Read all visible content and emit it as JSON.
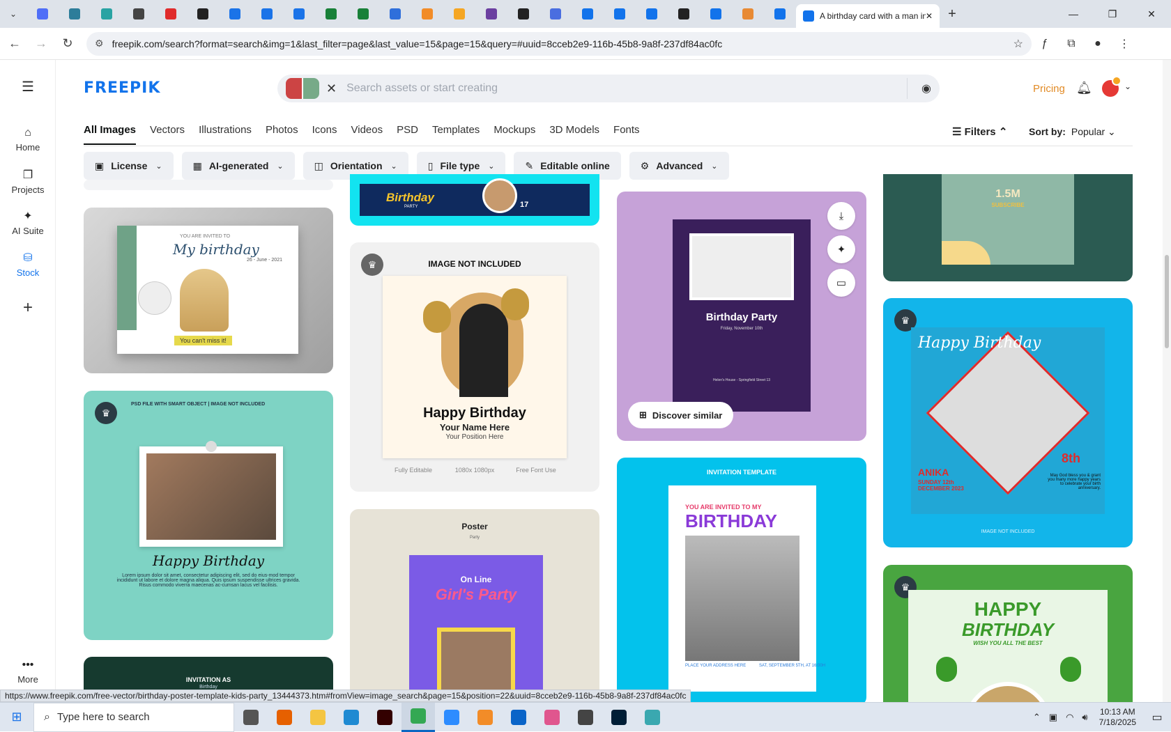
{
  "browser": {
    "active_tab_title": "A birthday card with a man in a",
    "url": "freepik.com/search?format=search&img=1&last_filter=page&last_value=15&page=15&query=#uuid=8cceb2e9-116b-45b8-9a8f-237df84ac0fc",
    "tab_favicon_colors": [
      "#4f6ef7",
      "#2d7d9a",
      "#29a3a3",
      "#444444",
      "#e02b2b",
      "#222222",
      "#1a73e8",
      "#1a73e8",
      "#1a73e8",
      "#188038",
      "#188038",
      "#2f6fdb",
      "#f28c28",
      "#f5a623",
      "#6b3fa0",
      "#222222",
      "#4a6ee0",
      "#1273eb",
      "#1273eb",
      "#1273eb",
      "#222222",
      "#1273eb",
      "#e88a34",
      "#1273eb"
    ]
  },
  "sidebar": {
    "items": [
      {
        "label": "Home",
        "icon": "home-icon",
        "glyph": "⌂"
      },
      {
        "label": "Projects",
        "icon": "projects-icon",
        "glyph": "❐"
      },
      {
        "label": "AI Suite",
        "icon": "sparkles-icon",
        "glyph": "✦"
      },
      {
        "label": "Stock",
        "icon": "stock-icon",
        "glyph": "⛁"
      }
    ],
    "add_glyph": "+",
    "more_label": "More",
    "active": "Stock"
  },
  "header": {
    "logo": "FREEPIK",
    "search_placeholder": "Search assets or start creating",
    "pricing": "Pricing"
  },
  "categories": [
    "All Images",
    "Vectors",
    "Illustrations",
    "Photos",
    "Icons",
    "Videos",
    "PSD",
    "Templates",
    "Mockups",
    "3D Models",
    "Fonts"
  ],
  "filters_label": "Filters",
  "sort": {
    "label": "Sort by:",
    "value": "Popular"
  },
  "filter_pills": [
    {
      "label": "License",
      "icon": "license-icon",
      "glyph": "▣"
    },
    {
      "label": "AI-generated",
      "icon": "ai-icon",
      "glyph": "▦"
    },
    {
      "label": "Orientation",
      "icon": "orientation-icon",
      "glyph": "◫"
    },
    {
      "label": "File type",
      "icon": "file-icon",
      "glyph": "▯"
    },
    {
      "label": "Editable online",
      "icon": "pencil-icon",
      "glyph": "✎"
    },
    {
      "label": "Advanced",
      "icon": "gear-icon",
      "glyph": "⚙"
    }
  ],
  "cards": {
    "c1": {
      "line1": "YOU ARE INVITED TO",
      "title": "My birthday",
      "date": "26 - June - 2021",
      "footer": "You can't miss it!"
    },
    "c2": {
      "header": "PSD FILE WITH SMART OBJECT | IMAGE NOT INCLUDED",
      "title": "Happy Birthday",
      "body": "Lorem ipsum dolor sit amet, consectetur adipiscing elit, sed do eius-mod tempor incididunt ut labore et dolore magna aliqua. Quis ipsum suspendisse ultrices gravida. Risus commodo viverra maecenas ac-cumsan lacus vel facilisis."
    },
    "c3": {
      "label": "INVITATION AS",
      "sub": "Birthday"
    },
    "c4": {
      "word": "Birthday",
      "sub": "PARTY",
      "num": "17"
    },
    "c5": {
      "header": "IMAGE NOT INCLUDED",
      "title": "Happy Birthday",
      "name": "Your Name Here",
      "position": "Your Position Here",
      "features": [
        "Fully Editable",
        "1080x 1080px",
        "Free Font Use"
      ]
    },
    "c6": {
      "title": "Poster",
      "sub": "Party",
      "line1": "On Line",
      "line2": "Girl's Party"
    },
    "c7": {
      "title": "Birthday Party",
      "date": "Friday, November 10th",
      "footer": "Helen's House - Springfield Street 13",
      "discover": "Discover similar"
    },
    "c8": {
      "header": "INVITATION TEMPLATE",
      "line1": "YOU ARE INVITED TO MY",
      "line2": "BIRTHDAY",
      "addr": "PLACE YOUR ADDRESS HERE",
      "date": "SAT, SEPTEMBER 5TH, AT 16:00H"
    },
    "c9": {
      "big": "1.5M",
      "sub": "SUBSCRIBE"
    },
    "c10": {
      "script": "Happy Birthday",
      "name": "ANIKA",
      "date": "SUNDAY 12th DECEMBER 2023",
      "age": "8th",
      "msg": "May God bless you & grant you many more happy years to celebrate your birth anniversary.",
      "foot": "IMAGE NOT INCLUDED"
    },
    "c11": {
      "line1": "HAPPY",
      "line2": "BIRTHDAY",
      "line3": "WISH YOU ALL THE BEST"
    }
  },
  "status_url": "https://www.freepik.com/free-vector/birthday-poster-template-kids-party_13444373.htm#fromView=image_search&page=15&position=22&uuid=8cceb2e9-116b-45b8-9a8f-237df84ac0fc",
  "taskbar": {
    "search_placeholder": "Type here to search",
    "time": "10:13 AM",
    "date": "7/18/2025",
    "apps": [
      "task-view",
      "firefox",
      "file-explorer",
      "vscode",
      "illustrator",
      "chrome",
      "zoom",
      "app-orange",
      "outlook",
      "app-pink",
      "pen-tool",
      "photoshop",
      "app-teal"
    ]
  }
}
